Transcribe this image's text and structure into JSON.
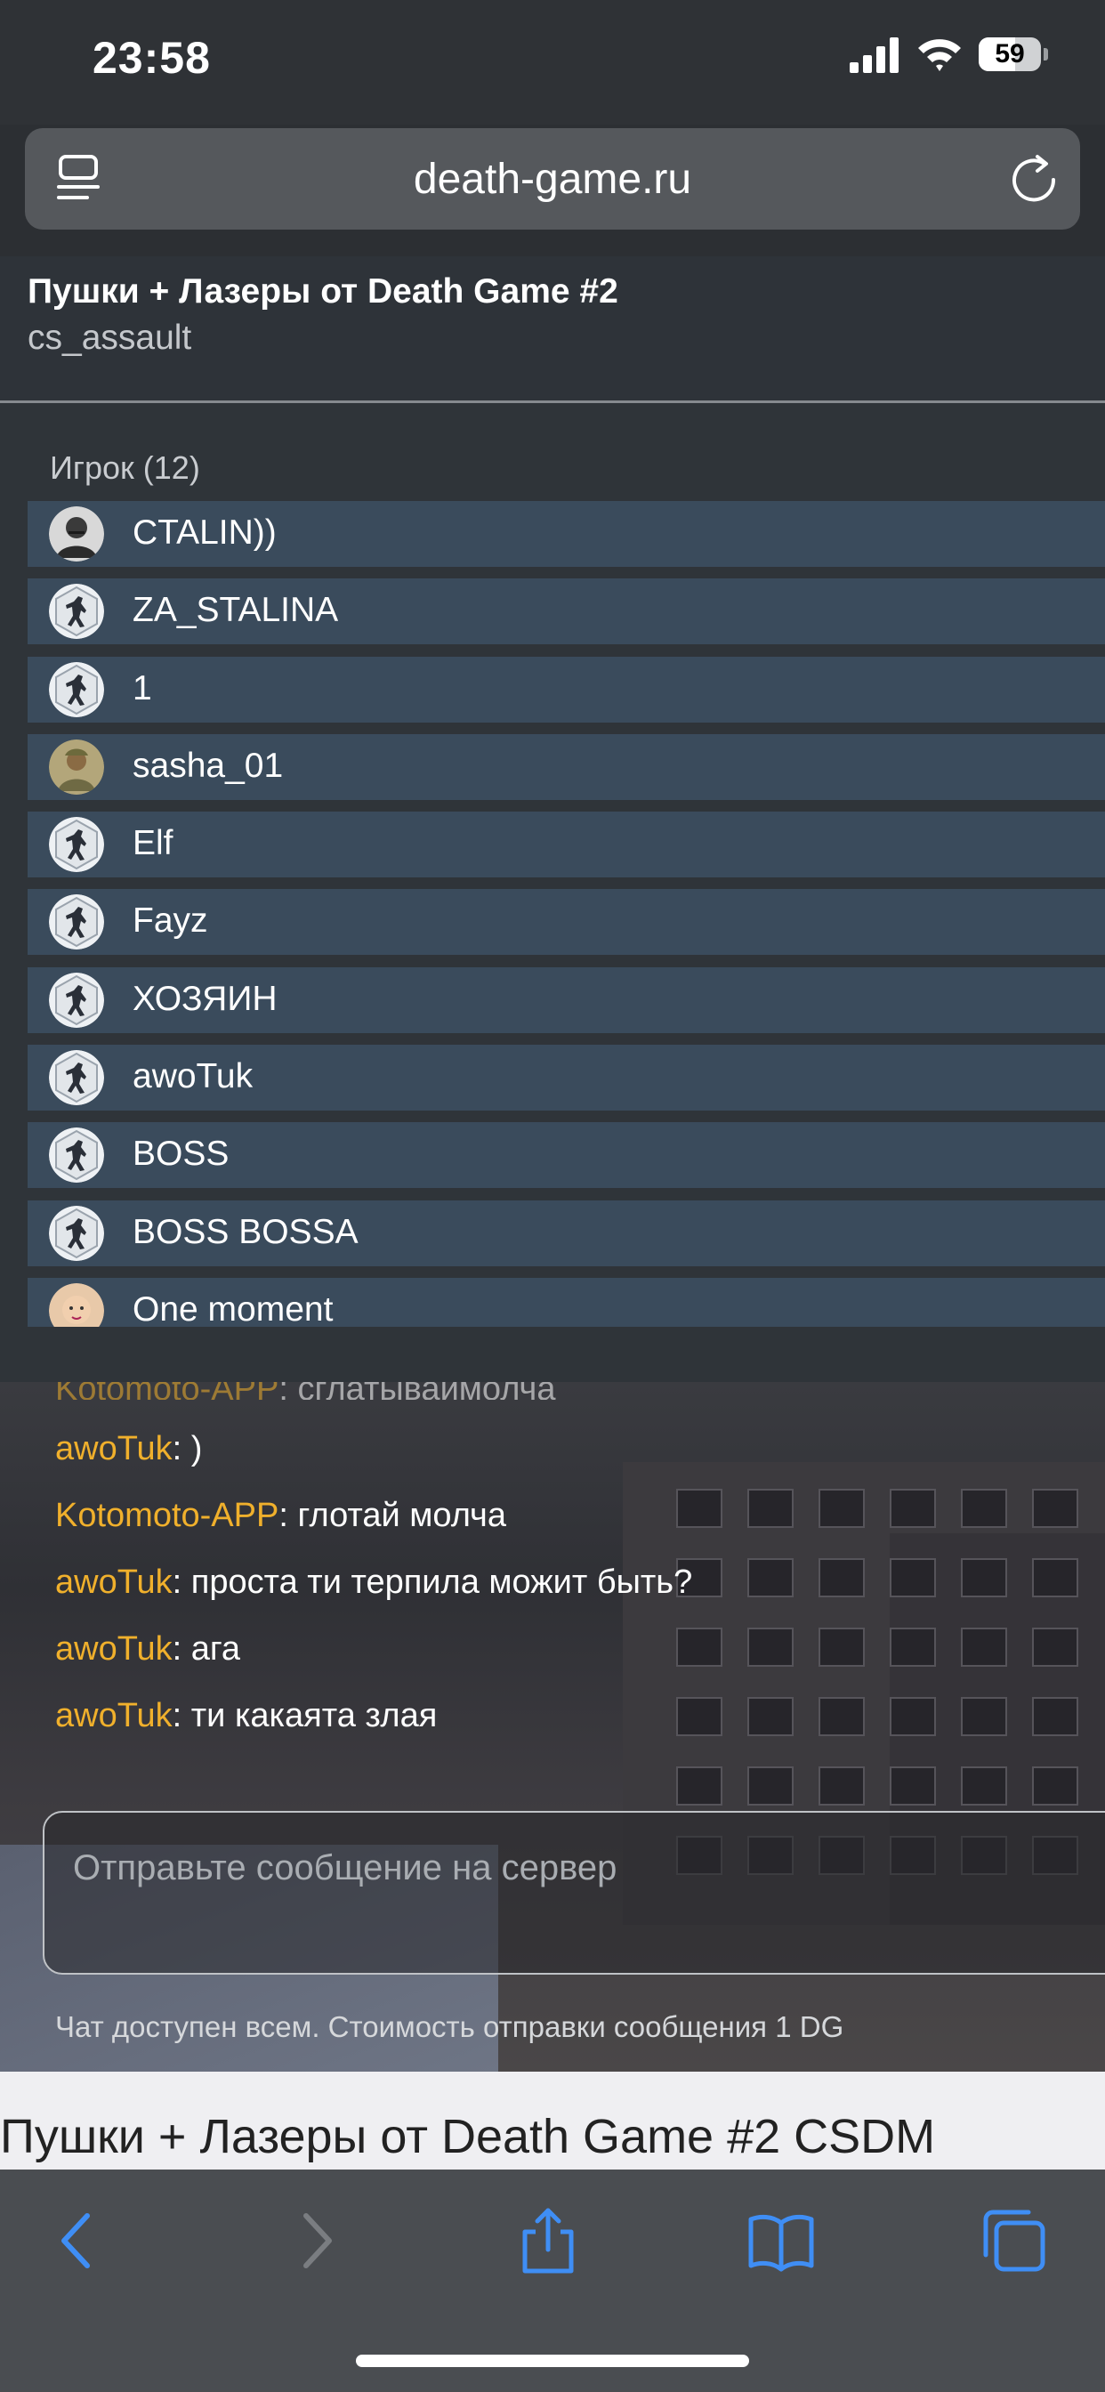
{
  "status_bar": {
    "time": "23:58",
    "battery": "59"
  },
  "browser": {
    "url": "death-game.ru"
  },
  "server": {
    "title": "Пушки + Лазеры от Death Game #2",
    "map": "cs_assault"
  },
  "players": {
    "header": "Игрок (12)",
    "items": [
      {
        "name": "CTALIN))",
        "avatar": "photo-avatar-icon"
      },
      {
        "name": "ZA_STALINA",
        "avatar": "counter-strike-icon"
      },
      {
        "name": "1",
        "avatar": "counter-strike-icon"
      },
      {
        "name": "sasha_01",
        "avatar": "soldier-avatar-icon"
      },
      {
        "name": "Elf",
        "avatar": "counter-strike-icon"
      },
      {
        "name": "Fayz",
        "avatar": "counter-strike-icon"
      },
      {
        "name": "ХОЗЯИН",
        "avatar": "counter-strike-icon"
      },
      {
        "name": "awoTuk",
        "avatar": "counter-strike-icon"
      },
      {
        "name": "BOSS",
        "avatar": "counter-strike-icon"
      },
      {
        "name": "BOSS BOSSA",
        "avatar": "counter-strike-icon"
      },
      {
        "name": "One moment",
        "avatar": "baby-avatar-icon"
      }
    ]
  },
  "chat": {
    "messages": [
      {
        "author": "Kotomoto-APP",
        "text": ": сглатываймолча"
      },
      {
        "author": "awoTuk",
        "text": ": )"
      },
      {
        "author": "Kotomoto-APP",
        "text": ": глотай молча"
      },
      {
        "author": "awoTuk",
        "text": ": проста ти терпила можит быть?"
      },
      {
        "author": "awoTuk",
        "text": ": ага"
      },
      {
        "author": "awoTuk",
        "text": ": ти какаята злая"
      }
    ],
    "input_placeholder": "Отправьте сообщение на сервер",
    "note": "Чат доступен всем. Стоимость отправки сообщения 1 DG"
  },
  "page_heading": "Пушки + Лазеры от Death Game #2 CSDM",
  "colors": {
    "author": "#f0b02c",
    "player_row": "#3a4b5c",
    "toolbar_icon": "#3f8ef5"
  }
}
